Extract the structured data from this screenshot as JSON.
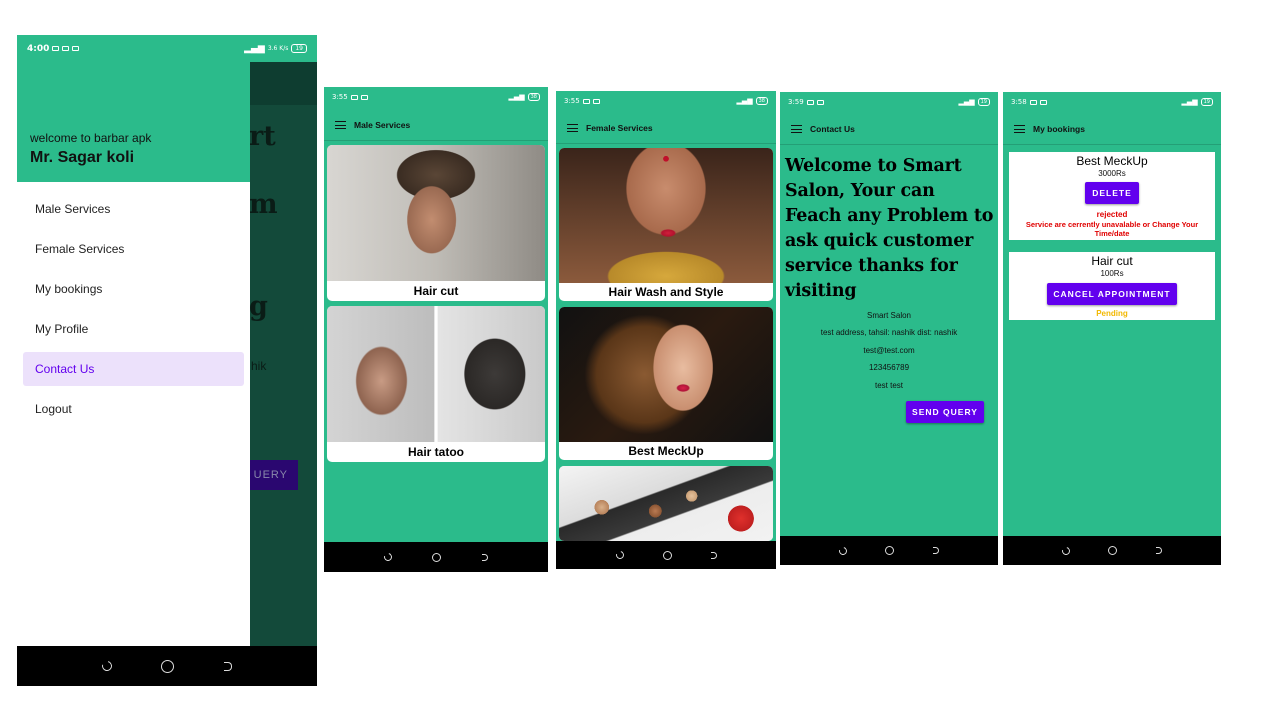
{
  "phone1": {
    "status_time": "4:00",
    "status_right": "3.6 K/s",
    "battery": "19",
    "drawer": {
      "welcome": "welcome to barbar apk",
      "user_name": "Mr. Sagar koli",
      "items": [
        {
          "label": "Male Services"
        },
        {
          "label": "Female Services"
        },
        {
          "label": "My bookings"
        },
        {
          "label": "My Profile"
        },
        {
          "label": "Contact Us",
          "selected": true
        },
        {
          "label": "Logout"
        }
      ]
    },
    "behind": {
      "heading_fragments": [
        "rt",
        "m",
        "g"
      ],
      "text_fragment": "hik",
      "button_fragment": "UERY"
    }
  },
  "phone2": {
    "status_time": "3:55",
    "battery": "38",
    "title": "Male Services",
    "cards": [
      {
        "label": "Hair cut"
      },
      {
        "label": "Hair tatoo"
      }
    ]
  },
  "phone3": {
    "status_time": "3:55",
    "battery": "38",
    "title": "Female Services",
    "cards": [
      {
        "label": "Hair Wash and Style"
      },
      {
        "label": "Best MeckUp"
      },
      {
        "label": ""
      }
    ]
  },
  "phone4": {
    "status_time": "3:59",
    "battery": "19",
    "title": "Contact Us",
    "headline": "Welcome to Smart Salon, Your can Feach any Problem to ask quick customer service thanks for visiting",
    "info": [
      "Smart Salon",
      "test address, tahsil: nashik dist: nashik",
      "test@test.com",
      "123456789",
      "test test"
    ],
    "button": "SEND QUERY"
  },
  "phone5": {
    "status_time": "3:58",
    "battery": "19",
    "title": "My bookings",
    "bookings": [
      {
        "name": "Best MeckUp",
        "price": "3000Rs",
        "button": "DELETE",
        "status": "rejected",
        "note": "Service are cerrently unavalable or Change Your Time/date"
      },
      {
        "name": "Hair cut",
        "price": "100Rs",
        "button": "CANCEL APPOINTMENT",
        "status": "Pending"
      }
    ]
  },
  "colors": {
    "primary": "#2bbb8b",
    "accent": "#6200ee",
    "rejected": "#e00000",
    "pending": "#f2b800",
    "drawer_selected_bg": "#ece1fb"
  }
}
